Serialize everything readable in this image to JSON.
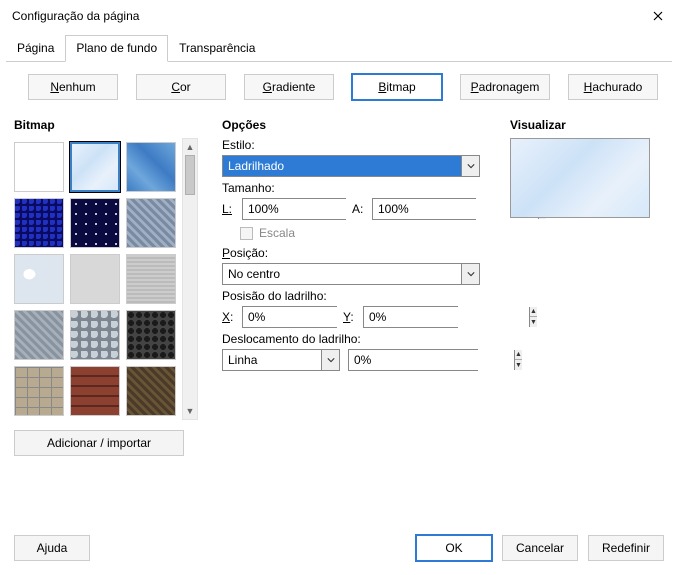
{
  "window": {
    "title": "Configuração da página"
  },
  "tabs": {
    "page": "Página",
    "background": "Plano de fundo",
    "transparency": "Transparência",
    "active": "background"
  },
  "modes": {
    "none": "Nenhum",
    "color": "Cor",
    "gradient": "Gradiente",
    "bitmap": "Bitmap",
    "pattern": "Padronagem",
    "hatch": "Hachurado",
    "active": "bitmap"
  },
  "sections": {
    "bitmap": "Bitmap",
    "options": "Opções",
    "preview": "Visualizar"
  },
  "add_import": "Adicionar / importar",
  "options": {
    "style_label": "Estilo:",
    "style_value": "Ladrilhado",
    "size_label": "Tamanho:",
    "width_label": "L:",
    "width_value": "100%",
    "height_label": "A:",
    "height_value": "100%",
    "scale_label": "Escala",
    "position_label": "Posição:",
    "position_value": "No centro",
    "tilepos_label": "Posisão do ladrilho:",
    "x_label": "X:",
    "x_value": "0%",
    "y_label": "Y:",
    "y_value": "0%",
    "offset_label": "Deslocamento do ladrilho:",
    "offset_mode": "Linha",
    "offset_value": "0%"
  },
  "footer": {
    "help": "Ajuda",
    "ok": "OK",
    "cancel": "Cancelar",
    "reset": "Redefinir"
  }
}
